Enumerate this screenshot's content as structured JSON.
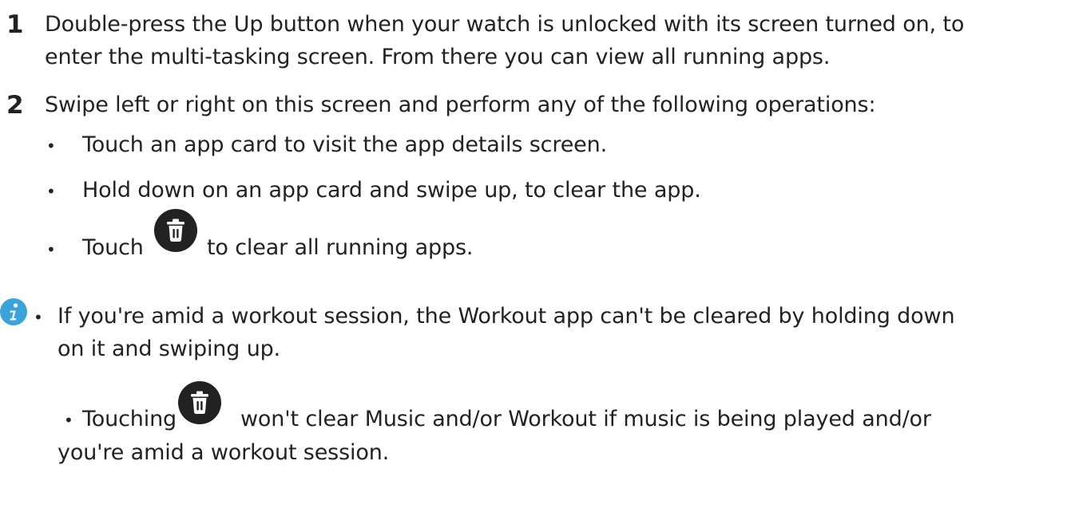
{
  "steps": [
    {
      "number": "1",
      "line1": "Double-press the Up button when your watch is unlocked with its screen turned on, to",
      "line2": "enter the multi-tasking screen. From there you can view all running apps."
    },
    {
      "number": "2",
      "line1": "Swipe left or right on this screen and perform any of the following operations:",
      "bullets": [
        {
          "text": "Touch an app card to visit the app details screen."
        },
        {
          "text": "Hold down on an app card and swipe up, to clear the app."
        },
        {
          "before": "Touch",
          "after": "to clear all running apps."
        }
      ]
    }
  ],
  "notes": [
    {
      "line1": "If you're amid a workout session, the Workout app can't be cleared by holding down",
      "line2": "on it and swiping up."
    },
    {
      "before": "Touching",
      "after": "won't clear Music and/or Workout if music is being played and/or",
      "line2": "you're amid a workout session."
    }
  ],
  "bullet_char": "•",
  "icons": {
    "trash": "trash-icon",
    "info": "info-icon",
    "trash_color": "#222222",
    "info_color": "#3aa3d9"
  }
}
